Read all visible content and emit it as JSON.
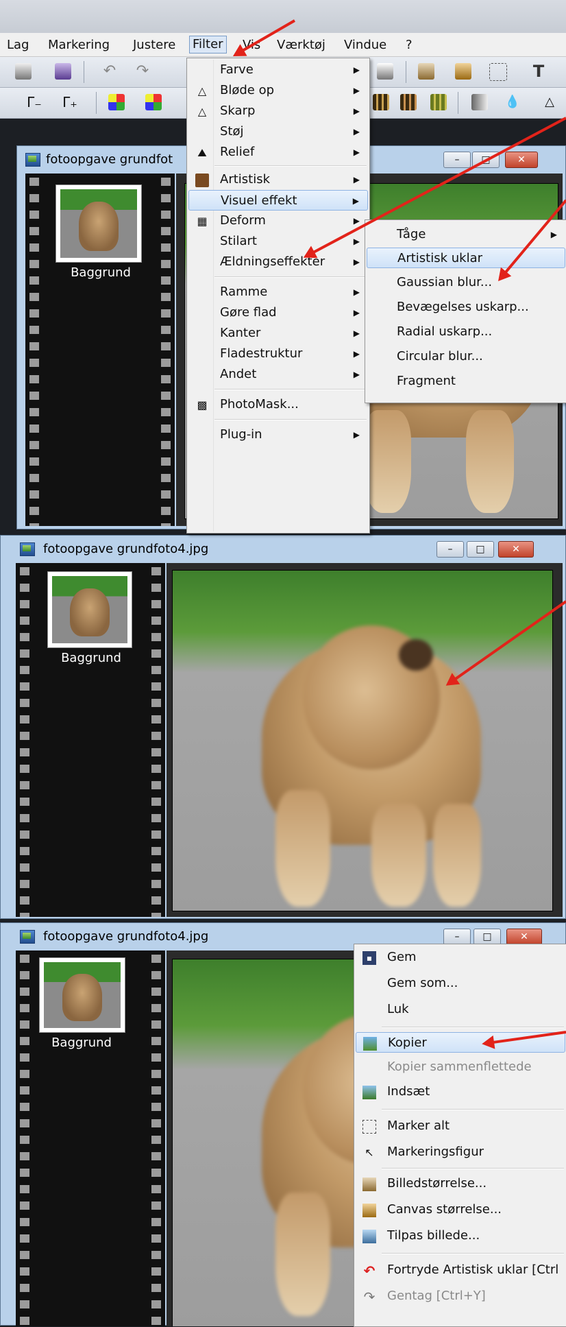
{
  "menubar": {
    "items": [
      "Lag",
      "Markering",
      "Justere",
      "Filter",
      "Vis",
      "Værktøj",
      "Vindue",
      "?"
    ]
  },
  "windows": [
    {
      "title": "fotoopgave grundfot",
      "layer_label": "Baggrund"
    },
    {
      "title": "fotoopgave grundfoto4.jpg",
      "layer_label": "Baggrund"
    },
    {
      "title": "fotoopgave grundfoto4.jpg",
      "layer_label": "Baggrund"
    }
  ],
  "window_buttons": {
    "minimize": "–",
    "maximize": "□",
    "close": "✕"
  },
  "filter_menu": {
    "items": [
      {
        "label": "Farve",
        "icon": "",
        "submenu": true
      },
      {
        "label": "Bløde op",
        "icon": "drop-icon",
        "submenu": true
      },
      {
        "label": "Skarp",
        "icon": "triangle-icon",
        "submenu": true
      },
      {
        "label": "Støj",
        "icon": "",
        "submenu": true
      },
      {
        "label": "Relief",
        "icon": "relief-icon",
        "submenu": true
      },
      {
        "label": "Artistisk",
        "icon": "artistic-icon",
        "submenu": true
      },
      {
        "label": "Visuel effekt",
        "icon": "",
        "submenu": true,
        "highlighted": true
      },
      {
        "label": "Deform",
        "icon": "deform-icon",
        "submenu": true
      },
      {
        "label": "Stilart",
        "icon": "",
        "submenu": true
      },
      {
        "label": "Ældningseffekter",
        "icon": "",
        "submenu": true
      },
      {
        "label": "Ramme",
        "icon": "",
        "submenu": true
      },
      {
        "label": "Gøre flad",
        "icon": "",
        "submenu": true
      },
      {
        "label": "Kanter",
        "icon": "",
        "submenu": true
      },
      {
        "label": "Fladestruktur",
        "icon": "",
        "submenu": true
      },
      {
        "label": "Andet",
        "icon": "",
        "submenu": true
      },
      {
        "label": "PhotoMask...",
        "icon": "photomask-icon",
        "submenu": false
      },
      {
        "label": "Plug-in",
        "icon": "",
        "submenu": true
      }
    ]
  },
  "visual_effect_submenu": {
    "items": [
      {
        "label": "Tåge",
        "submenu": true
      },
      {
        "label": "Artistisk uklar",
        "highlighted": true
      },
      {
        "label": "Gaussian blur..."
      },
      {
        "label": "Bevægelses uskarp..."
      },
      {
        "label": "Radial uskarp..."
      },
      {
        "label": "Circular blur..."
      },
      {
        "label": "Fragment"
      }
    ]
  },
  "context_menu": {
    "items": [
      {
        "label": "Gem",
        "icon": "save-icon"
      },
      {
        "label": "Gem som...",
        "icon": ""
      },
      {
        "label": "Luk",
        "icon": ""
      },
      {
        "label": "Kopier",
        "icon": "copy-icon",
        "highlighted": true
      },
      {
        "label": "Kopier sammenflettede",
        "icon": "",
        "disabled": true
      },
      {
        "label": "Indsæt",
        "icon": "paste-icon"
      },
      {
        "label": "Marker alt",
        "icon": "select-all-icon"
      },
      {
        "label": "Markeringsfigur",
        "icon": "pointer-icon"
      },
      {
        "label": "Billedstørrelse...",
        "icon": "image-size-icon"
      },
      {
        "label": "Canvas størrelse...",
        "icon": "canvas-size-icon"
      },
      {
        "label": "Tilpas billede...",
        "icon": "fit-image-icon"
      },
      {
        "label": "Fortryde Artistisk uklar [Ctrl",
        "icon": "undo-icon"
      },
      {
        "label": "Gentag [Ctrl+Y]",
        "icon": "redo-icon",
        "disabled": true
      }
    ]
  },
  "colors": {
    "highlight": "#cfe2f8",
    "arrow": "#e2231a",
    "window_frame": "#b9d1ea"
  }
}
